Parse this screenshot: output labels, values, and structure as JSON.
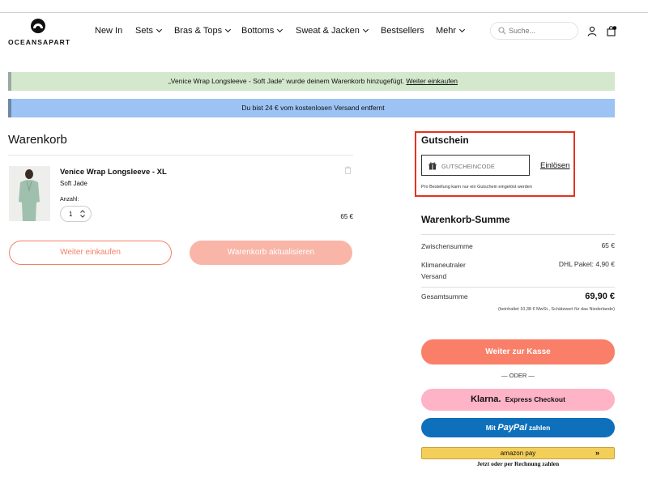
{
  "header": {
    "brand": "OCEANSAPART",
    "nav": [
      {
        "label": "New In",
        "has_menu": false
      },
      {
        "label": "Sets",
        "has_menu": true
      },
      {
        "label": "Bras & Tops",
        "has_menu": true
      },
      {
        "label": "Bottoms",
        "has_menu": true
      },
      {
        "label": "Sweat & Jacken",
        "has_menu": true
      },
      {
        "label": "Bestsellers",
        "has_menu": false
      },
      {
        "label": "Mehr",
        "has_menu": true
      }
    ],
    "search_placeholder": "Suche..."
  },
  "banners": {
    "added_text": "„Venice Wrap Longsleeve - Soft Jade“ wurde deinem Warenkorb hinzugefügt.",
    "added_link": "Weiter einkaufen",
    "shipping_text": "Du bist 24 € vom kostenlosen Versand entfernt"
  },
  "cart": {
    "title": "Warenkorb",
    "item": {
      "name": "Venice Wrap Longsleeve - XL",
      "variant": "Soft Jade",
      "qty_label": "Anzahl:",
      "qty": "1",
      "price": "65 €"
    },
    "continue_label": "Weiter einkaufen",
    "update_label": "Warenkorb aktualisieren"
  },
  "coupon": {
    "title": "Gutschein",
    "placeholder": "GUTSCHEINCODE",
    "redeem_label": "Einlösen",
    "note": "Pro Bestellung kann nur ein Gutschein eingelöst werden"
  },
  "summary": {
    "title": "Warenkorb-Summe",
    "subtotal_label": "Zwischensumme",
    "subtotal_value": "65 €",
    "shipping_label": "Klimaneutraler Versand",
    "shipping_value": "DHL Paket: 4,90 €",
    "total_label": "Gesamtsumme",
    "total_value": "69,90 €",
    "tax_note": "(beinhaltet 10,38 € MwSt., Schätzwert für das Niederlande)"
  },
  "payment": {
    "checkout_label": "Weiter zur Kasse",
    "or_label": "— ODER —",
    "klarna_logo": "Klarna.",
    "klarna_label": "Express Checkout",
    "paypal_prefix": "Mit",
    "paypal_logo": "PayPal",
    "paypal_suffix": "zahlen",
    "amazon_label": "amazon pay",
    "amazon_arrow": "»",
    "amazon_note": "Jetzt oder per Rechnung zahlen"
  },
  "colors": {
    "accent": "#f97f68",
    "coupon_highlight": "#e53220",
    "success_bg": "#d3e8cc",
    "info_bg": "#9cc3f4",
    "klarna": "#feb3c7",
    "paypal": "#0e70ba",
    "amazon": "#f3cf5a"
  }
}
